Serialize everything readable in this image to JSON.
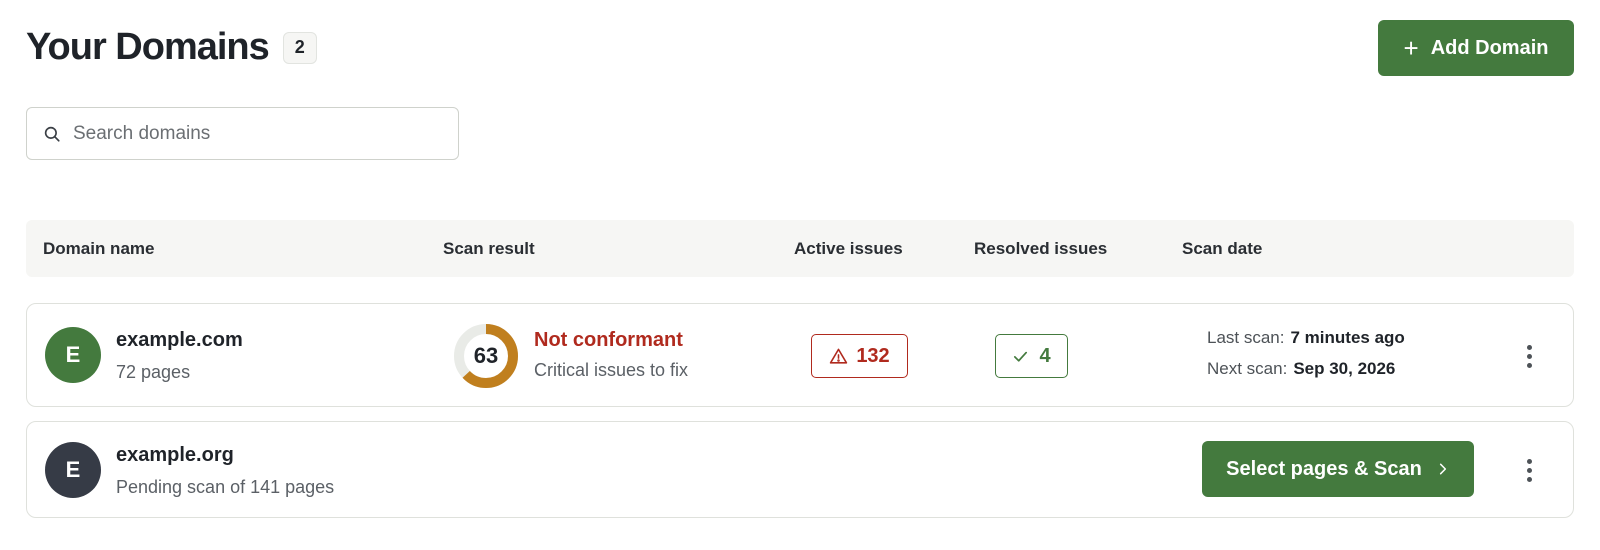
{
  "header": {
    "title": "Your Domains",
    "count": "2",
    "add_button_label": "Add Domain"
  },
  "search": {
    "placeholder": "Search domains",
    "value": ""
  },
  "table": {
    "columns": [
      "Domain name",
      "Scan result",
      "Active issues",
      "Resolved issues",
      "Scan date"
    ]
  },
  "rows": [
    {
      "avatar_letter": "E",
      "domain": "example.com",
      "subtitle": "72 pages",
      "score": "63",
      "score_fraction": 0.63,
      "status": "Not conformant",
      "status_note": "Critical issues to fix",
      "active_issues": "132",
      "resolved_issues": "4",
      "last_scan_label": "Last scan:",
      "last_scan_value": "7 minutes ago",
      "next_scan_label": "Next scan:",
      "next_scan_value": "Sep 30, 2026"
    },
    {
      "avatar_letter": "E",
      "domain": "example.org",
      "subtitle": "Pending scan of 141 pages",
      "scan_button_label": "Select pages & Scan"
    }
  ],
  "icons": {
    "add": "plus-icon",
    "search": "search-icon",
    "active_issues": "warning-icon",
    "resolved_issues": "check-icon",
    "scan_button": "chevron-right-icon",
    "row_menu": "kebab-menu-icon"
  },
  "colors": {
    "primary": "#447a3e",
    "danger": "#b02a1e",
    "score_ring": "#c07f1e",
    "score_track": "#e9ebe7",
    "avatar_pending": "#363b46"
  }
}
